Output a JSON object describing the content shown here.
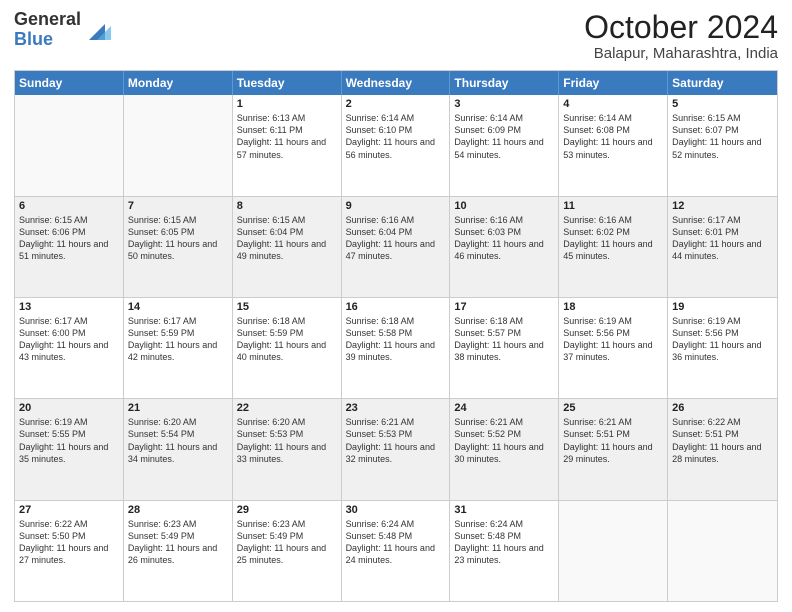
{
  "logo": {
    "general": "General",
    "blue": "Blue"
  },
  "title": "October 2024",
  "location": "Balapur, Maharashtra, India",
  "header_days": [
    "Sunday",
    "Monday",
    "Tuesday",
    "Wednesday",
    "Thursday",
    "Friday",
    "Saturday"
  ],
  "weeks": [
    [
      {
        "day": "",
        "sunrise": "",
        "sunset": "",
        "daylight": "",
        "empty": true
      },
      {
        "day": "",
        "sunrise": "",
        "sunset": "",
        "daylight": "",
        "empty": true
      },
      {
        "day": "1",
        "sunrise": "Sunrise: 6:13 AM",
        "sunset": "Sunset: 6:11 PM",
        "daylight": "Daylight: 11 hours and 57 minutes."
      },
      {
        "day": "2",
        "sunrise": "Sunrise: 6:14 AM",
        "sunset": "Sunset: 6:10 PM",
        "daylight": "Daylight: 11 hours and 56 minutes."
      },
      {
        "day": "3",
        "sunrise": "Sunrise: 6:14 AM",
        "sunset": "Sunset: 6:09 PM",
        "daylight": "Daylight: 11 hours and 54 minutes."
      },
      {
        "day": "4",
        "sunrise": "Sunrise: 6:14 AM",
        "sunset": "Sunset: 6:08 PM",
        "daylight": "Daylight: 11 hours and 53 minutes."
      },
      {
        "day": "5",
        "sunrise": "Sunrise: 6:15 AM",
        "sunset": "Sunset: 6:07 PM",
        "daylight": "Daylight: 11 hours and 52 minutes."
      }
    ],
    [
      {
        "day": "6",
        "sunrise": "Sunrise: 6:15 AM",
        "sunset": "Sunset: 6:06 PM",
        "daylight": "Daylight: 11 hours and 51 minutes."
      },
      {
        "day": "7",
        "sunrise": "Sunrise: 6:15 AM",
        "sunset": "Sunset: 6:05 PM",
        "daylight": "Daylight: 11 hours and 50 minutes."
      },
      {
        "day": "8",
        "sunrise": "Sunrise: 6:15 AM",
        "sunset": "Sunset: 6:04 PM",
        "daylight": "Daylight: 11 hours and 49 minutes."
      },
      {
        "day": "9",
        "sunrise": "Sunrise: 6:16 AM",
        "sunset": "Sunset: 6:04 PM",
        "daylight": "Daylight: 11 hours and 47 minutes."
      },
      {
        "day": "10",
        "sunrise": "Sunrise: 6:16 AM",
        "sunset": "Sunset: 6:03 PM",
        "daylight": "Daylight: 11 hours and 46 minutes."
      },
      {
        "day": "11",
        "sunrise": "Sunrise: 6:16 AM",
        "sunset": "Sunset: 6:02 PM",
        "daylight": "Daylight: 11 hours and 45 minutes."
      },
      {
        "day": "12",
        "sunrise": "Sunrise: 6:17 AM",
        "sunset": "Sunset: 6:01 PM",
        "daylight": "Daylight: 11 hours and 44 minutes."
      }
    ],
    [
      {
        "day": "13",
        "sunrise": "Sunrise: 6:17 AM",
        "sunset": "Sunset: 6:00 PM",
        "daylight": "Daylight: 11 hours and 43 minutes."
      },
      {
        "day": "14",
        "sunrise": "Sunrise: 6:17 AM",
        "sunset": "Sunset: 5:59 PM",
        "daylight": "Daylight: 11 hours and 42 minutes."
      },
      {
        "day": "15",
        "sunrise": "Sunrise: 6:18 AM",
        "sunset": "Sunset: 5:59 PM",
        "daylight": "Daylight: 11 hours and 40 minutes."
      },
      {
        "day": "16",
        "sunrise": "Sunrise: 6:18 AM",
        "sunset": "Sunset: 5:58 PM",
        "daylight": "Daylight: 11 hours and 39 minutes."
      },
      {
        "day": "17",
        "sunrise": "Sunrise: 6:18 AM",
        "sunset": "Sunset: 5:57 PM",
        "daylight": "Daylight: 11 hours and 38 minutes."
      },
      {
        "day": "18",
        "sunrise": "Sunrise: 6:19 AM",
        "sunset": "Sunset: 5:56 PM",
        "daylight": "Daylight: 11 hours and 37 minutes."
      },
      {
        "day": "19",
        "sunrise": "Sunrise: 6:19 AM",
        "sunset": "Sunset: 5:56 PM",
        "daylight": "Daylight: 11 hours and 36 minutes."
      }
    ],
    [
      {
        "day": "20",
        "sunrise": "Sunrise: 6:19 AM",
        "sunset": "Sunset: 5:55 PM",
        "daylight": "Daylight: 11 hours and 35 minutes."
      },
      {
        "day": "21",
        "sunrise": "Sunrise: 6:20 AM",
        "sunset": "Sunset: 5:54 PM",
        "daylight": "Daylight: 11 hours and 34 minutes."
      },
      {
        "day": "22",
        "sunrise": "Sunrise: 6:20 AM",
        "sunset": "Sunset: 5:53 PM",
        "daylight": "Daylight: 11 hours and 33 minutes."
      },
      {
        "day": "23",
        "sunrise": "Sunrise: 6:21 AM",
        "sunset": "Sunset: 5:53 PM",
        "daylight": "Daylight: 11 hours and 32 minutes."
      },
      {
        "day": "24",
        "sunrise": "Sunrise: 6:21 AM",
        "sunset": "Sunset: 5:52 PM",
        "daylight": "Daylight: 11 hours and 30 minutes."
      },
      {
        "day": "25",
        "sunrise": "Sunrise: 6:21 AM",
        "sunset": "Sunset: 5:51 PM",
        "daylight": "Daylight: 11 hours and 29 minutes."
      },
      {
        "day": "26",
        "sunrise": "Sunrise: 6:22 AM",
        "sunset": "Sunset: 5:51 PM",
        "daylight": "Daylight: 11 hours and 28 minutes."
      }
    ],
    [
      {
        "day": "27",
        "sunrise": "Sunrise: 6:22 AM",
        "sunset": "Sunset: 5:50 PM",
        "daylight": "Daylight: 11 hours and 27 minutes."
      },
      {
        "day": "28",
        "sunrise": "Sunrise: 6:23 AM",
        "sunset": "Sunset: 5:49 PM",
        "daylight": "Daylight: 11 hours and 26 minutes."
      },
      {
        "day": "29",
        "sunrise": "Sunrise: 6:23 AM",
        "sunset": "Sunset: 5:49 PM",
        "daylight": "Daylight: 11 hours and 25 minutes."
      },
      {
        "day": "30",
        "sunrise": "Sunrise: 6:24 AM",
        "sunset": "Sunset: 5:48 PM",
        "daylight": "Daylight: 11 hours and 24 minutes."
      },
      {
        "day": "31",
        "sunrise": "Sunrise: 6:24 AM",
        "sunset": "Sunset: 5:48 PM",
        "daylight": "Daylight: 11 hours and 23 minutes."
      },
      {
        "day": "",
        "sunrise": "",
        "sunset": "",
        "daylight": "",
        "empty": true
      },
      {
        "day": "",
        "sunrise": "",
        "sunset": "",
        "daylight": "",
        "empty": true
      }
    ]
  ]
}
